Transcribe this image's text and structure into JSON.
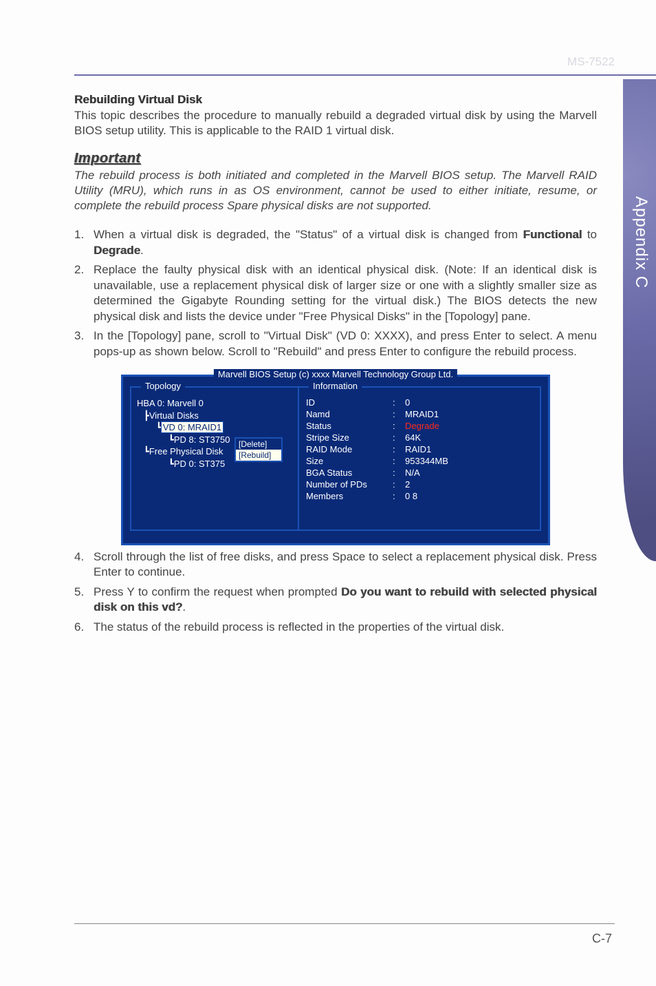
{
  "doc_id": "MS-7522",
  "side_tab": "Appendix C",
  "page_number": "C-7",
  "section_title": "Rebuilding Virtual Disk",
  "intro_text": "This topic describes the procedure to manually rebuild a degraded virtual disk by using the Marvell BIOS setup utility. This is applicable to the RAID 1 virtual disk.",
  "important_label": "Important",
  "important_text": "The rebuild process is both initiated and completed in the Marvell BIOS setup. The Marvell RAID Utility (MRU), which runs in as OS environment, cannot be used to either initiate, resume, or complete the rebuild process Spare physical disks are not supported.",
  "steps_a": {
    "s1_a": "When a virtual disk is degraded, the \"Status\" of a virtual disk is changed from ",
    "s1_b": "Functional",
    "s1_c": " to ",
    "s1_d": "Degrade",
    "s1_e": ".",
    "s2": "Replace the faulty physical disk with an identical physical disk. (Note: If an identical disk is unavailable, use a replacement physical disk of larger size or one with a slightly smaller size as determined the Gigabyte Rounding setting for the virtual disk.) The BIOS detects the new physical disk and lists the device under \"Free Physical Disks\" in the [Topology] pane.",
    "s3": "In the [Topology] pane, scroll to \"Virtual Disk\" (VD 0: XXXX), and press Enter to select. A menu pops-up as shown below. Scroll to \"Rebuild\" and press Enter to configure the rebuild process."
  },
  "steps_b": {
    "s4": "Scroll through the list of free disks, and press Space to select a replacement physical disk. Press Enter to continue.",
    "s5_a": "Press Y to confirm the request when prompted ",
    "s5_b": "Do you want to rebuild with selected physical disk on this vd?",
    "s5_c": ".",
    "s6": "The status of the rebuild process is reflected in the properties of the virtual disk."
  },
  "bios": {
    "title": "Marvell BIOS Setup (c) xxxx Marvell Technology Group Ltd.",
    "left_label": "Topology",
    "right_label": "Information",
    "tree": {
      "hba": "HBA 0: Marvell 0",
      "vdisks": "Virtual Disks",
      "vd0": "VD  0: MRAID1",
      "pd8": "PD 8: ST3750",
      "freepd": "Free Physical Disk",
      "pd0": "PD 0:  ST375"
    },
    "menu": {
      "delete": "[Delete]",
      "rebuild": "[Rebuild]"
    },
    "info": [
      {
        "label": "ID",
        "value": "0"
      },
      {
        "label": "Namd",
        "value": "MRAID1"
      },
      {
        "label": "Status",
        "value": "Degrade",
        "red": true
      },
      {
        "label": "Stripe  Size",
        "value": "64K"
      },
      {
        "label": "RAID  Mode",
        "value": "RAID1"
      },
      {
        "label": "Size",
        "value": "953344MB"
      },
      {
        "label": "BGA  Status",
        "value": "N/A"
      },
      {
        "label": "Number  of  PDs",
        "value": "2"
      },
      {
        "label": "Members",
        "value": "0   8"
      }
    ]
  }
}
